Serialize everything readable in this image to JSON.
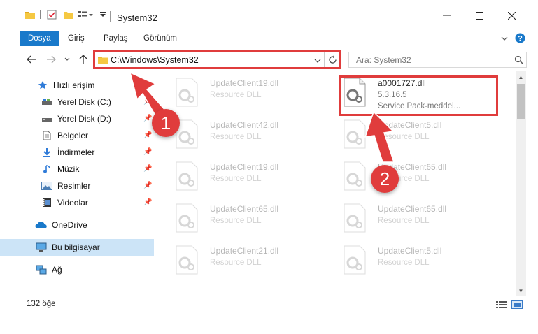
{
  "window": {
    "title": "System32",
    "minimize": "—",
    "maximize": "☐",
    "close": "✕"
  },
  "ribbon": {
    "tabs": [
      {
        "label": "Dosya",
        "active": true
      },
      {
        "label": "Giriş"
      },
      {
        "label": "Paylaş"
      },
      {
        "label": "Görünüm"
      }
    ]
  },
  "address": {
    "path": "C:\\Windows\\System32",
    "search_placeholder": "Ara: System32"
  },
  "sidebar": {
    "items": [
      {
        "label": "Hızlı erişim",
        "icon": "star-icon",
        "pinned": false
      },
      {
        "label": "Yerel Disk (C:)",
        "icon": "drive-icon",
        "pinned": true
      },
      {
        "label": "Yerel Disk (D:)",
        "icon": "drive-icon",
        "pinned": true
      },
      {
        "label": "Belgeler",
        "icon": "documents-icon",
        "pinned": true
      },
      {
        "label": "İndirmeler",
        "icon": "download-icon",
        "pinned": true
      },
      {
        "label": "Müzik",
        "icon": "music-icon",
        "pinned": true
      },
      {
        "label": "Resimler",
        "icon": "pictures-icon",
        "pinned": true
      },
      {
        "label": "Videolar",
        "icon": "video-icon",
        "pinned": true
      },
      {
        "label": "OneDrive",
        "icon": "cloud-icon",
        "pinned": false
      },
      {
        "label": "Bu bilgisayar",
        "icon": "computer-icon",
        "pinned": false,
        "selected": true
      },
      {
        "label": "Ağ",
        "icon": "network-icon",
        "pinned": false
      }
    ]
  },
  "files": [
    {
      "name": "UpdateClient19.dll",
      "type": "Resource DLL",
      "faded": true
    },
    {
      "name": "a0001727.dll",
      "version": "5.3.16.5",
      "description": "Service Pack-meddel...",
      "faded": false
    },
    {
      "name": "UpdateClient42.dll",
      "type": "Resource DLL",
      "faded": true
    },
    {
      "name": "UpdateClient5.dll",
      "type": "Resource DLL",
      "faded": true
    },
    {
      "name": "UpdateClient19.dll",
      "type": "Resource DLL",
      "faded": true
    },
    {
      "name": "UpdateClient65.dll",
      "type": "Resource DLL",
      "faded": true
    },
    {
      "name": "UpdateClient65.dll",
      "type": "Resource DLL",
      "faded": true
    },
    {
      "name": "UpdateClient65.dll",
      "type": "Resource DLL",
      "faded": true
    },
    {
      "name": "UpdateClient21.dll",
      "type": "Resource DLL",
      "faded": true
    },
    {
      "name": "UpdateClient5.dll",
      "type": "Resource DLL",
      "faded": true
    }
  ],
  "status": {
    "count": "132 öğe"
  },
  "annotations": {
    "step1": "1",
    "step2": "2",
    "color": "#e03c3c"
  },
  "colors": {
    "accent": "#1979ca",
    "selection": "#cce4f7"
  }
}
